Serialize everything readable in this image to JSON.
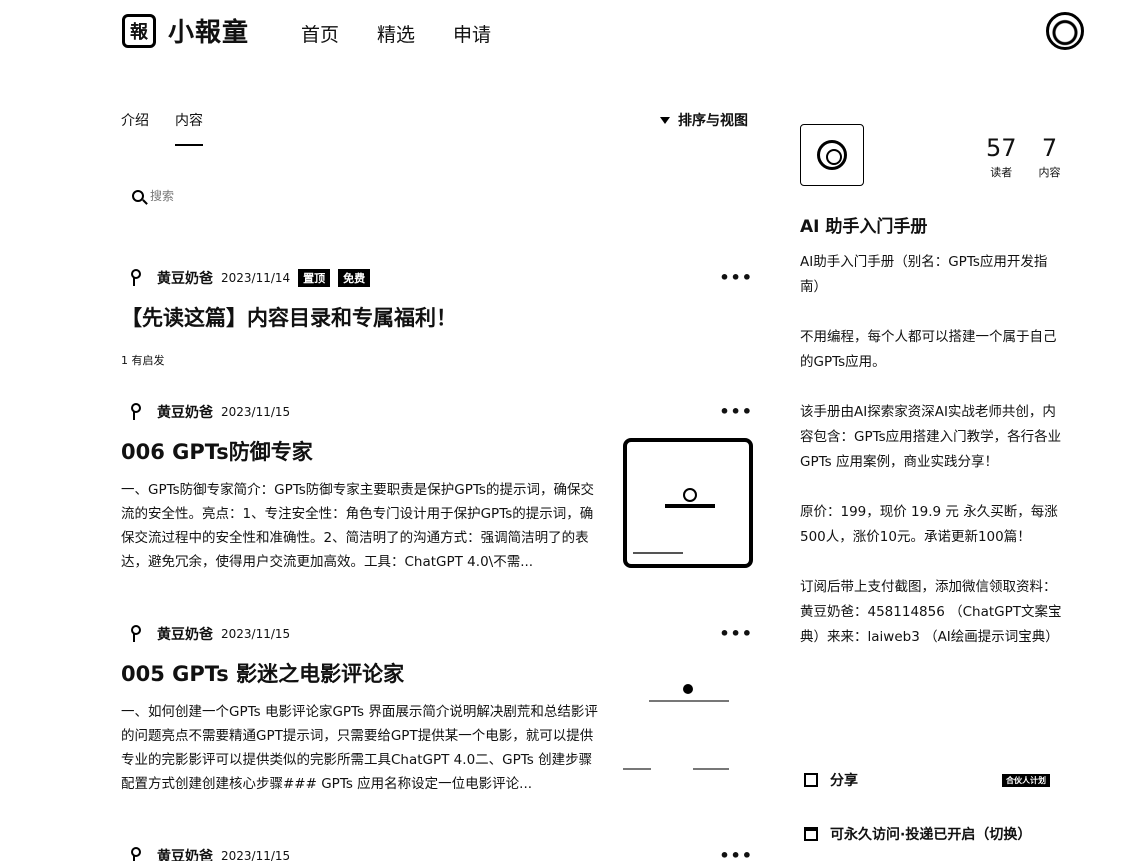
{
  "header": {
    "logo_glyph": "報",
    "logo_text": "小報童",
    "nav": [
      "首页",
      "精选",
      "申请"
    ]
  },
  "tabs": [
    "介绍",
    "内容"
  ],
  "sort_label": "排序与视图",
  "search_placeholder": "搜索",
  "posts": [
    {
      "author": "黄豆奶爸",
      "date": "2023/11/14",
      "badges": [
        "置顶",
        "免费"
      ],
      "title": "【先读这篇】内容目录和专属福利！",
      "sub": "1 有启发"
    },
    {
      "author": "黄豆奶爸",
      "date": "2023/11/15",
      "title": "006 GPTs防御专家",
      "excerpt": "一、GPTs防御专家简介：GPTs防御专家主要职责是保护GPTs的提示词，确保交流的安全性。亮点：1、专注安全性：角色专门设计用于保护GPTs的提示词，确保交流过程中的安全性和准确性。2、简洁明了的沟通方式：强调简洁明了的表达，避免冗余，使得用户交流更加高效。工具：ChatGPT 4.0\\不需..."
    },
    {
      "author": "黄豆奶爸",
      "date": "2023/11/15",
      "title": "005 GPTs 影迷之电影评论家",
      "excerpt": "一、如何创建一个GPTs 电影评论家GPTs 界面展示简介说明解决剧荒和总结影评的问题亮点不需要精通GPT提示词，只需要给GPT提供某一个电影，就可以提供专业的完影影评可以提供类似的完影所需工具ChatGPT 4.0二、GPTs 创建步骤配置方式创建创建核心步骤### GPTs 应用名称设定一位电影评论..."
    },
    {
      "author": "黄豆奶爸",
      "date": "2023/11/15"
    }
  ],
  "sidebar": {
    "stats": [
      {
        "num": "57",
        "label": "读者"
      },
      {
        "num": "7",
        "label": "内容"
      }
    ],
    "title": "AI 助手入门手册",
    "desc": [
      "AI助手入门手册（别名：GPTs应用开发指南）",
      "不用编程，每个人都可以搭建一个属于自己的GPTs应用。",
      "该手册由AI探索家资深AI实战老师共创，内容包含：GPTs应用搭建入门教学，各行各业GPTs 应用案例，商业实践分享！",
      "原价：199，现价 19.9 元 永久买断，每涨500人，涨价10元。承诺更新100篇！",
      "订阅后带上支付截图，添加微信领取资料：黄豆奶爸：458114856 （ChatGPT文案宝典）来来：laiweb3 （AI绘画提示词宝典）"
    ],
    "share_label": "分享",
    "partner_label": "合伙人计划",
    "access_label": "可永久访问·投递已开启（切换）"
  }
}
